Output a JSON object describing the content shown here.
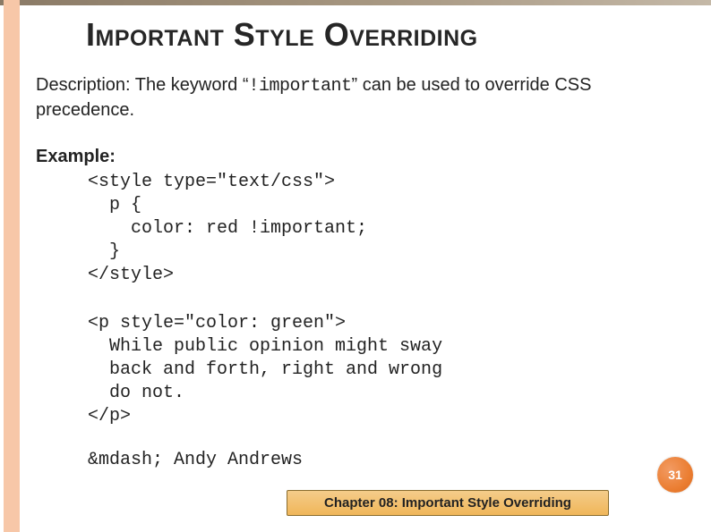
{
  "title": "Important Style Overriding",
  "description_prefix": "Description: The keyword “",
  "description_keyword": "!important",
  "description_suffix": "” can be used to override CSS precedence.",
  "example_label": "Example:",
  "code_block_1": "<style type=\"text/css\">\n  p {\n    color: red !important;\n  }\n</style>",
  "code_block_2": "<p style=\"color: green\">\n  While public opinion might sway\n  back and forth, right and wrong\n  do not.\n</p>",
  "author_line": "&mdash; Andy Andrews",
  "footer": "Chapter 08: Important Style Overriding",
  "page_number": "31"
}
